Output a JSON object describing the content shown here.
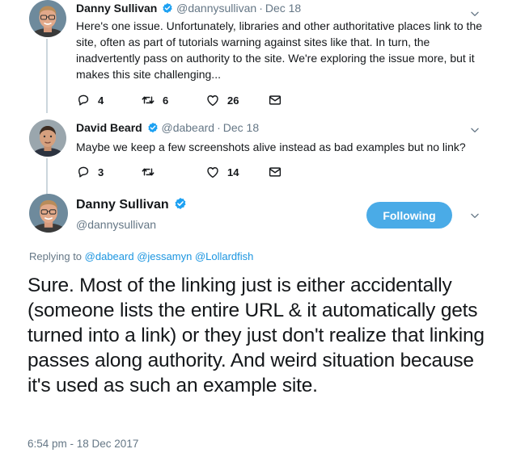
{
  "tweet1": {
    "name": "Danny Sullivan",
    "handle": "@dannysullivan",
    "separator": "·",
    "date": "Dec 18",
    "text": "Here's one issue. Unfortunately, libraries and other authoritative places link to the site, often as part of tutorials warning against sites like that. In turn, the inadvertently pass on authority to the site. We're exploring the issue more, but it makes this site challenging...",
    "replies": "4",
    "retweets": "6",
    "likes": "26"
  },
  "tweet2": {
    "name": "David Beard",
    "handle": "@dabeard",
    "separator": "·",
    "date": "Dec 18",
    "text": "Maybe we keep a few screenshots alive instead as bad examples but no link?",
    "replies": "3",
    "retweets": "",
    "likes": "14"
  },
  "main_tweet": {
    "name": "Danny Sullivan",
    "handle": "@dannysullivan",
    "follow_label": "Following",
    "replying_prefix": "Replying to",
    "replying_to": [
      "@dabeard",
      "@jessamyn",
      "@Lollardfish"
    ],
    "text": "Sure. Most of the linking just is either accidentally (someone lists the entire URL & it automatically gets turned into a link) or they just don't realize that linking passes along authority. And weird situation because it's used as such an example site.",
    "timestamp": "6:54 pm - 18 Dec 2017"
  },
  "colors": {
    "accent": "#1da1f2",
    "follow_button": "#4aabe7",
    "muted": "#657786",
    "link": "#1b95e0"
  },
  "icons": [
    "verified-badge-icon",
    "reply-icon",
    "retweet-icon",
    "like-icon",
    "direct-message-icon",
    "chevron-down-icon"
  ]
}
